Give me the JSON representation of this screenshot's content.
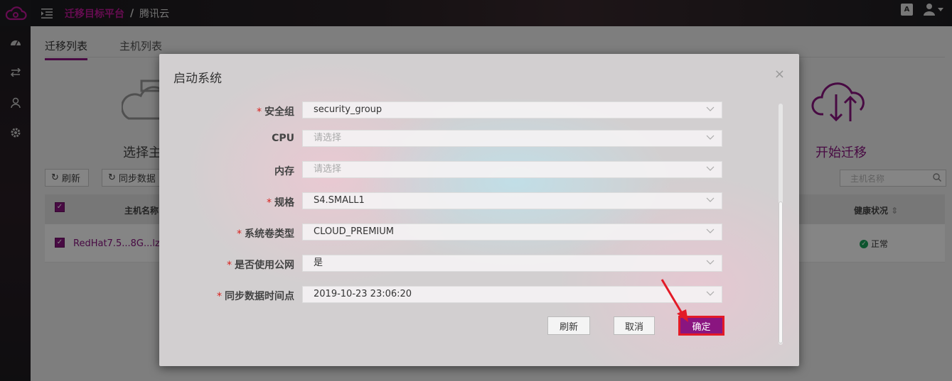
{
  "header": {
    "logo": "cloud-logo-icon",
    "menu_icon": "menu-indent-icon",
    "breadcrumb": {
      "platform": "迁移目标平台",
      "separator": "/",
      "cloud": "腾讯云"
    },
    "lang_icon_text": "A",
    "user_icon": "user-icon"
  },
  "sidebar": {
    "items": [
      {
        "icon": "dashboard-icon"
      },
      {
        "icon": "transfer-icon"
      },
      {
        "icon": "user-group-icon"
      },
      {
        "icon": "gear-icon"
      }
    ]
  },
  "main": {
    "tabs": [
      {
        "label": "迁移列表",
        "active": true
      },
      {
        "label": "主机列表",
        "active": false
      }
    ],
    "steps": {
      "left_label": "选择主",
      "right_label": "开始迁移"
    },
    "toolbar": {
      "refresh_label": "刷新",
      "sync_label": "同步数据"
    },
    "search_placeholder": "主机名称",
    "table": {
      "col_hostname": "主机名称",
      "col_health": "健康状况",
      "rows": [
        {
          "hostname": "RedHat7.5...8G...lzy",
          "health": "正常"
        }
      ]
    }
  },
  "modal": {
    "title": "启动系统",
    "close": "×",
    "fields": [
      {
        "label": "安全组",
        "required": true,
        "value": "security_group",
        "placeholder": ""
      },
      {
        "label": "CPU",
        "required": false,
        "value": "",
        "placeholder": "请选择"
      },
      {
        "label": "内存",
        "required": false,
        "value": "",
        "placeholder": "请选择"
      },
      {
        "label": "规格",
        "required": true,
        "value": "S4.SMALL1",
        "placeholder": ""
      },
      {
        "label": "系统卷类型",
        "required": true,
        "value": "CLOUD_PREMIUM",
        "placeholder": ""
      },
      {
        "label": "是否使用公网",
        "required": true,
        "value": "是",
        "placeholder": ""
      },
      {
        "label": "同步数据时间点",
        "required": true,
        "value": "2019-10-23 23:06:20",
        "placeholder": ""
      }
    ],
    "buttons": {
      "refresh": "刷新",
      "cancel": "取消",
      "confirm": "确定"
    }
  },
  "colors": {
    "accent": "#8a1580",
    "required": "#d9211d",
    "success": "#1aa35a",
    "annotation": "#e31a27"
  }
}
